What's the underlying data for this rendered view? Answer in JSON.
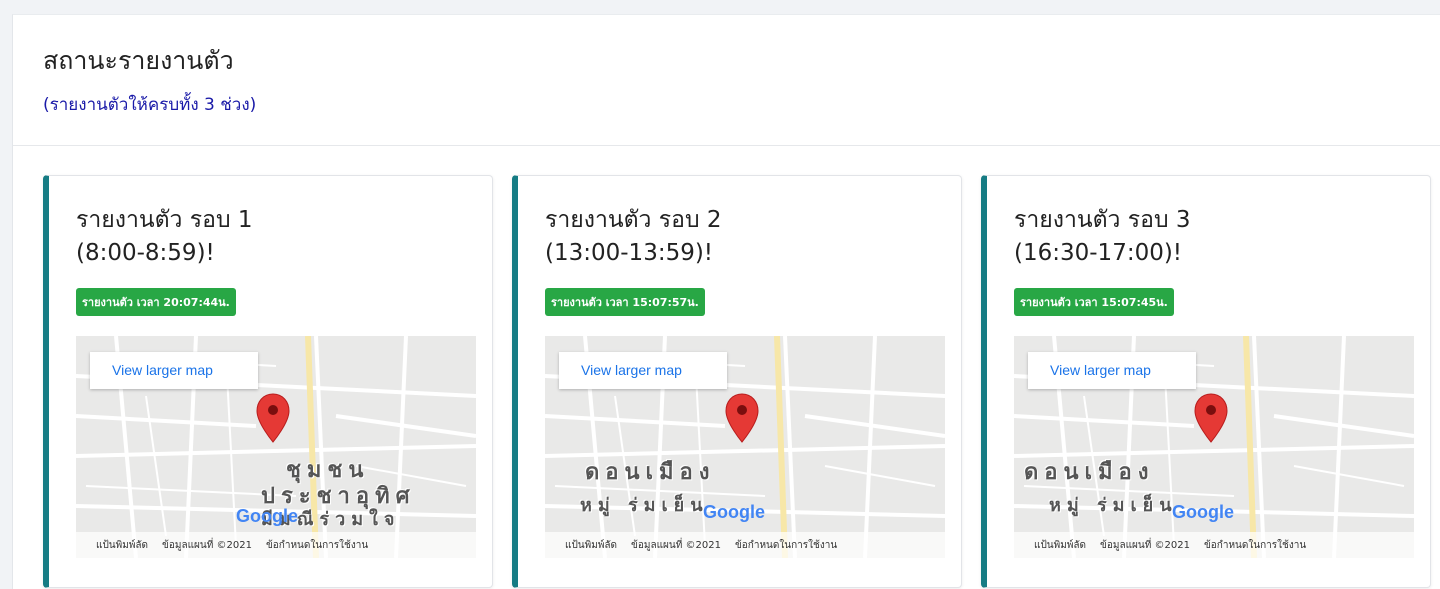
{
  "header": {
    "title": "สถานะรายงานตัว",
    "subtitle": "(รายงานตัวให้ครบทั้ง 3 ช่วง)"
  },
  "cards": [
    {
      "title_line1": "รายงานตัว รอบ 1",
      "title_line2": "(8:00-8:59)!",
      "badge": "รายงานตัว เวลา 20:07:44น.",
      "map_link": "View larger map",
      "map_labels": [
        "ชุมชน",
        "ประชาอุทิศ",
        "มีมณีร่วมใจ"
      ],
      "footer": [
        "แป้นพิมพ์ลัด",
        "ข้อมูลแผนที่ ©2021",
        "ข้อกำหนดในการใช้งาน"
      ]
    },
    {
      "title_line1": "รายงานตัว รอบ 2",
      "title_line2": "(13:00-13:59)!",
      "badge": "รายงานตัว เวลา 15:07:57น.",
      "map_link": "View larger map",
      "map_labels": [
        "ดอนเมือง",
        "หมู่ ร่มเย็น"
      ],
      "footer": [
        "แป้นพิมพ์ลัด",
        "ข้อมูลแผนที่ ©2021",
        "ข้อกำหนดในการใช้งาน"
      ]
    },
    {
      "title_line1": "รายงานตัว รอบ 3",
      "title_line2": "(16:30-17:00)!",
      "badge": "รายงานตัว เวลา 15:07:45น.",
      "map_link": "View larger map",
      "map_labels": [
        "ดอนเมือง",
        "หมู่ ร่มเย็น"
      ],
      "footer": [
        "แป้นพิมพ์ลัด",
        "ข้อมูลแผนที่ ©2021",
        "ข้อกำหนดในการใช้งาน"
      ]
    }
  ],
  "google_logo": "Google",
  "colors": {
    "accent": "#167c84",
    "badge": "#28a745",
    "subtitle": "#1a1aa8",
    "pin": "#e53935",
    "link": "#1a73e8"
  }
}
